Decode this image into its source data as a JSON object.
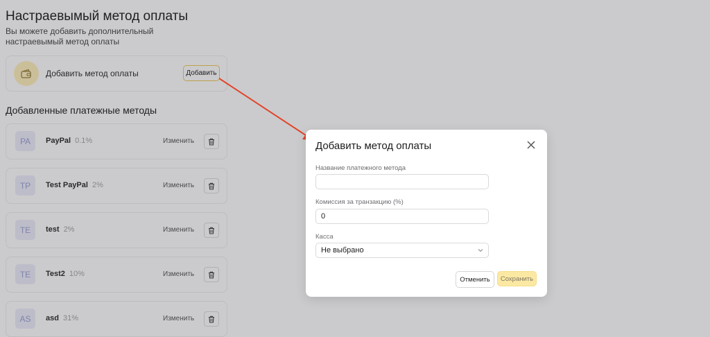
{
  "page": {
    "title": "Настраевымый метод оплаты",
    "subtitle": "Вы можете добавить дополнительный настраевымый метод оплаты",
    "add_card": {
      "label": "Добавить метод оплаты",
      "button": "Добавить",
      "icon": "wallet-icon"
    },
    "list_title": "Добавленные платежные методы",
    "edit_label": "Изменить",
    "methods": [
      {
        "initials": "PA",
        "name": "PayPal",
        "fee": "0.1%"
      },
      {
        "initials": "TP",
        "name": "Test PayPal",
        "fee": "2%"
      },
      {
        "initials": "TE",
        "name": "test",
        "fee": "2%"
      },
      {
        "initials": "TE",
        "name": "Test2",
        "fee": "10%"
      },
      {
        "initials": "AS",
        "name": "asd",
        "fee": "31%"
      }
    ]
  },
  "modal": {
    "title": "Добавить метод оплаты",
    "name_label": "Название платежного метода",
    "name_value": "",
    "fee_label": "Комиссия за транзакцию (%)",
    "fee_value": "0",
    "cashbox_label": "Касса",
    "cashbox_value": "Не выбрано",
    "cancel": "Отменить",
    "save": "Сохранить"
  },
  "colors": {
    "accent": "#fbe9a3",
    "annotation_arrow": "#e2452b",
    "overlay": "#cbcbcd"
  }
}
